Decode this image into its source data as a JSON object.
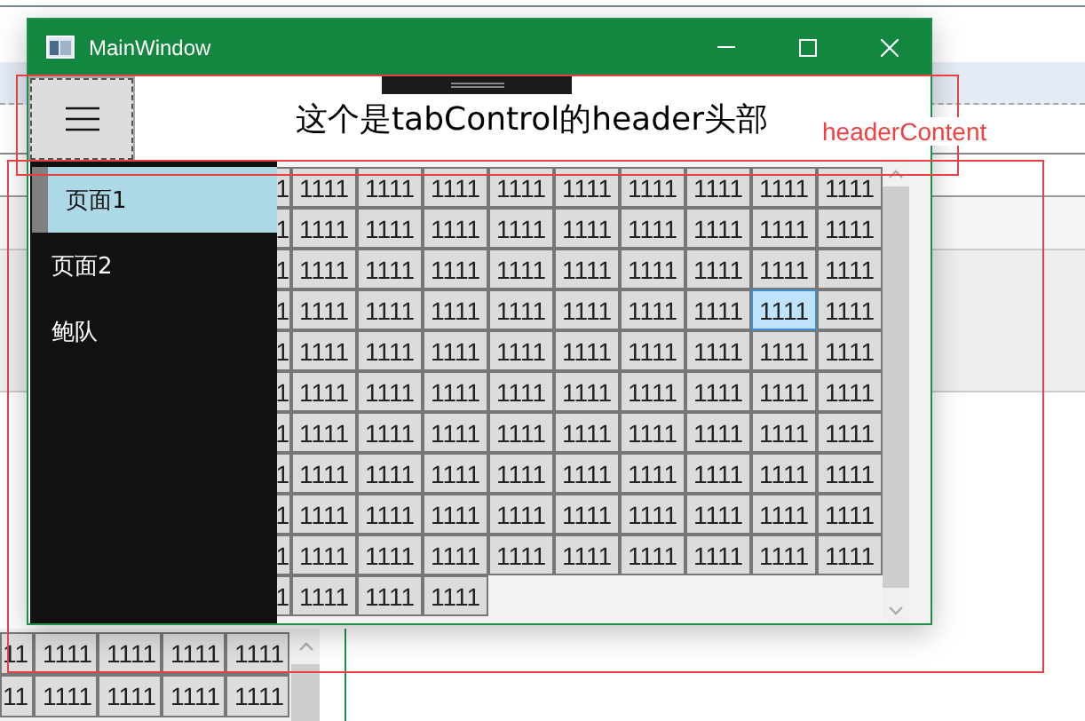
{
  "window": {
    "title": "MainWindow"
  },
  "header": {
    "title": "这个是tabControl的header头部"
  },
  "nav": {
    "items": [
      {
        "label": "页面1",
        "selected": true
      },
      {
        "label": "页面2",
        "selected": false
      },
      {
        "label": "鲍队",
        "selected": false
      }
    ]
  },
  "grid": {
    "rows": [
      {
        "cells": [
          {
            "text": "1",
            "selected": false
          },
          {
            "text": "1111",
            "selected": false
          },
          {
            "text": "1111",
            "selected": false
          },
          {
            "text": "1111",
            "selected": false
          },
          {
            "text": "1111",
            "selected": false
          },
          {
            "text": "1111",
            "selected": false
          },
          {
            "text": "1111",
            "selected": false
          },
          {
            "text": "1111",
            "selected": false
          },
          {
            "text": "1111",
            "selected": false
          },
          {
            "text": "1111",
            "selected": false
          }
        ]
      },
      {
        "cells": [
          {
            "text": "1",
            "selected": false
          },
          {
            "text": "1111",
            "selected": false
          },
          {
            "text": "1111",
            "selected": false
          },
          {
            "text": "1111",
            "selected": false
          },
          {
            "text": "1111",
            "selected": false
          },
          {
            "text": "1111",
            "selected": false
          },
          {
            "text": "1111",
            "selected": false
          },
          {
            "text": "1111",
            "selected": false
          },
          {
            "text": "1111",
            "selected": false
          },
          {
            "text": "1111",
            "selected": false
          }
        ]
      },
      {
        "cells": [
          {
            "text": "1",
            "selected": false
          },
          {
            "text": "1111",
            "selected": false
          },
          {
            "text": "1111",
            "selected": false
          },
          {
            "text": "1111",
            "selected": false
          },
          {
            "text": "1111",
            "selected": false
          },
          {
            "text": "1111",
            "selected": false
          },
          {
            "text": "1111",
            "selected": false
          },
          {
            "text": "1111",
            "selected": false
          },
          {
            "text": "1111",
            "selected": false
          },
          {
            "text": "1111",
            "selected": false
          }
        ]
      },
      {
        "cells": [
          {
            "text": "1",
            "selected": false
          },
          {
            "text": "1111",
            "selected": false
          },
          {
            "text": "1111",
            "selected": false
          },
          {
            "text": "1111",
            "selected": false
          },
          {
            "text": "1111",
            "selected": false
          },
          {
            "text": "1111",
            "selected": false
          },
          {
            "text": "1111",
            "selected": false
          },
          {
            "text": "1111",
            "selected": false
          },
          {
            "text": "1111",
            "selected": true
          },
          {
            "text": "1111",
            "selected": false
          }
        ]
      },
      {
        "cells": [
          {
            "text": "1",
            "selected": false
          },
          {
            "text": "1111",
            "selected": false
          },
          {
            "text": "1111",
            "selected": false
          },
          {
            "text": "1111",
            "selected": false
          },
          {
            "text": "1111",
            "selected": false
          },
          {
            "text": "1111",
            "selected": false
          },
          {
            "text": "1111",
            "selected": false
          },
          {
            "text": "1111",
            "selected": false
          },
          {
            "text": "1111",
            "selected": false
          },
          {
            "text": "1111",
            "selected": false
          }
        ]
      },
      {
        "cells": [
          {
            "text": "1",
            "selected": false
          },
          {
            "text": "1111",
            "selected": false
          },
          {
            "text": "1111",
            "selected": false
          },
          {
            "text": "1111",
            "selected": false
          },
          {
            "text": "1111",
            "selected": false
          },
          {
            "text": "1111",
            "selected": false
          },
          {
            "text": "1111",
            "selected": false
          },
          {
            "text": "1111",
            "selected": false
          },
          {
            "text": "1111",
            "selected": false
          },
          {
            "text": "1111",
            "selected": false
          }
        ]
      },
      {
        "cells": [
          {
            "text": "1",
            "selected": false
          },
          {
            "text": "1111",
            "selected": false
          },
          {
            "text": "1111",
            "selected": false
          },
          {
            "text": "1111",
            "selected": false
          },
          {
            "text": "1111",
            "selected": false
          },
          {
            "text": "1111",
            "selected": false
          },
          {
            "text": "1111",
            "selected": false
          },
          {
            "text": "1111",
            "selected": false
          },
          {
            "text": "1111",
            "selected": false
          },
          {
            "text": "1111",
            "selected": false
          }
        ]
      },
      {
        "cells": [
          {
            "text": "1",
            "selected": false
          },
          {
            "text": "1111",
            "selected": false
          },
          {
            "text": "1111",
            "selected": false
          },
          {
            "text": "1111",
            "selected": false
          },
          {
            "text": "1111",
            "selected": false
          },
          {
            "text": "1111",
            "selected": false
          },
          {
            "text": "1111",
            "selected": false
          },
          {
            "text": "1111",
            "selected": false
          },
          {
            "text": "1111",
            "selected": false
          },
          {
            "text": "1111",
            "selected": false
          }
        ]
      },
      {
        "cells": [
          {
            "text": "1",
            "selected": false
          },
          {
            "text": "1111",
            "selected": false
          },
          {
            "text": "1111",
            "selected": false
          },
          {
            "text": "1111",
            "selected": false
          },
          {
            "text": "1111",
            "selected": false
          },
          {
            "text": "1111",
            "selected": false
          },
          {
            "text": "1111",
            "selected": false
          },
          {
            "text": "1111",
            "selected": false
          },
          {
            "text": "1111",
            "selected": false
          },
          {
            "text": "1111",
            "selected": false
          }
        ]
      },
      {
        "cells": [
          {
            "text": "1",
            "selected": false
          },
          {
            "text": "1111",
            "selected": false
          },
          {
            "text": "1111",
            "selected": false
          },
          {
            "text": "1111",
            "selected": false
          },
          {
            "text": "1111",
            "selected": false
          },
          {
            "text": "1111",
            "selected": false
          },
          {
            "text": "1111",
            "selected": false
          },
          {
            "text": "1111",
            "selected": false
          },
          {
            "text": "1111",
            "selected": false
          },
          {
            "text": "1111",
            "selected": false
          }
        ]
      },
      {
        "cells": [
          {
            "text": "1",
            "selected": false
          },
          {
            "text": "1111",
            "selected": false
          },
          {
            "text": "1111",
            "selected": false
          },
          {
            "text": "1111",
            "selected": false
          }
        ]
      }
    ]
  },
  "adorner": {
    "label": "headerContent"
  },
  "background_grid": {
    "rows": [
      {
        "cells": [
          "11",
          "1111",
          "1111",
          "1111",
          "1111"
        ]
      },
      {
        "cells": [
          "11",
          "1111",
          "1111",
          "1111",
          "1111"
        ]
      }
    ]
  }
}
